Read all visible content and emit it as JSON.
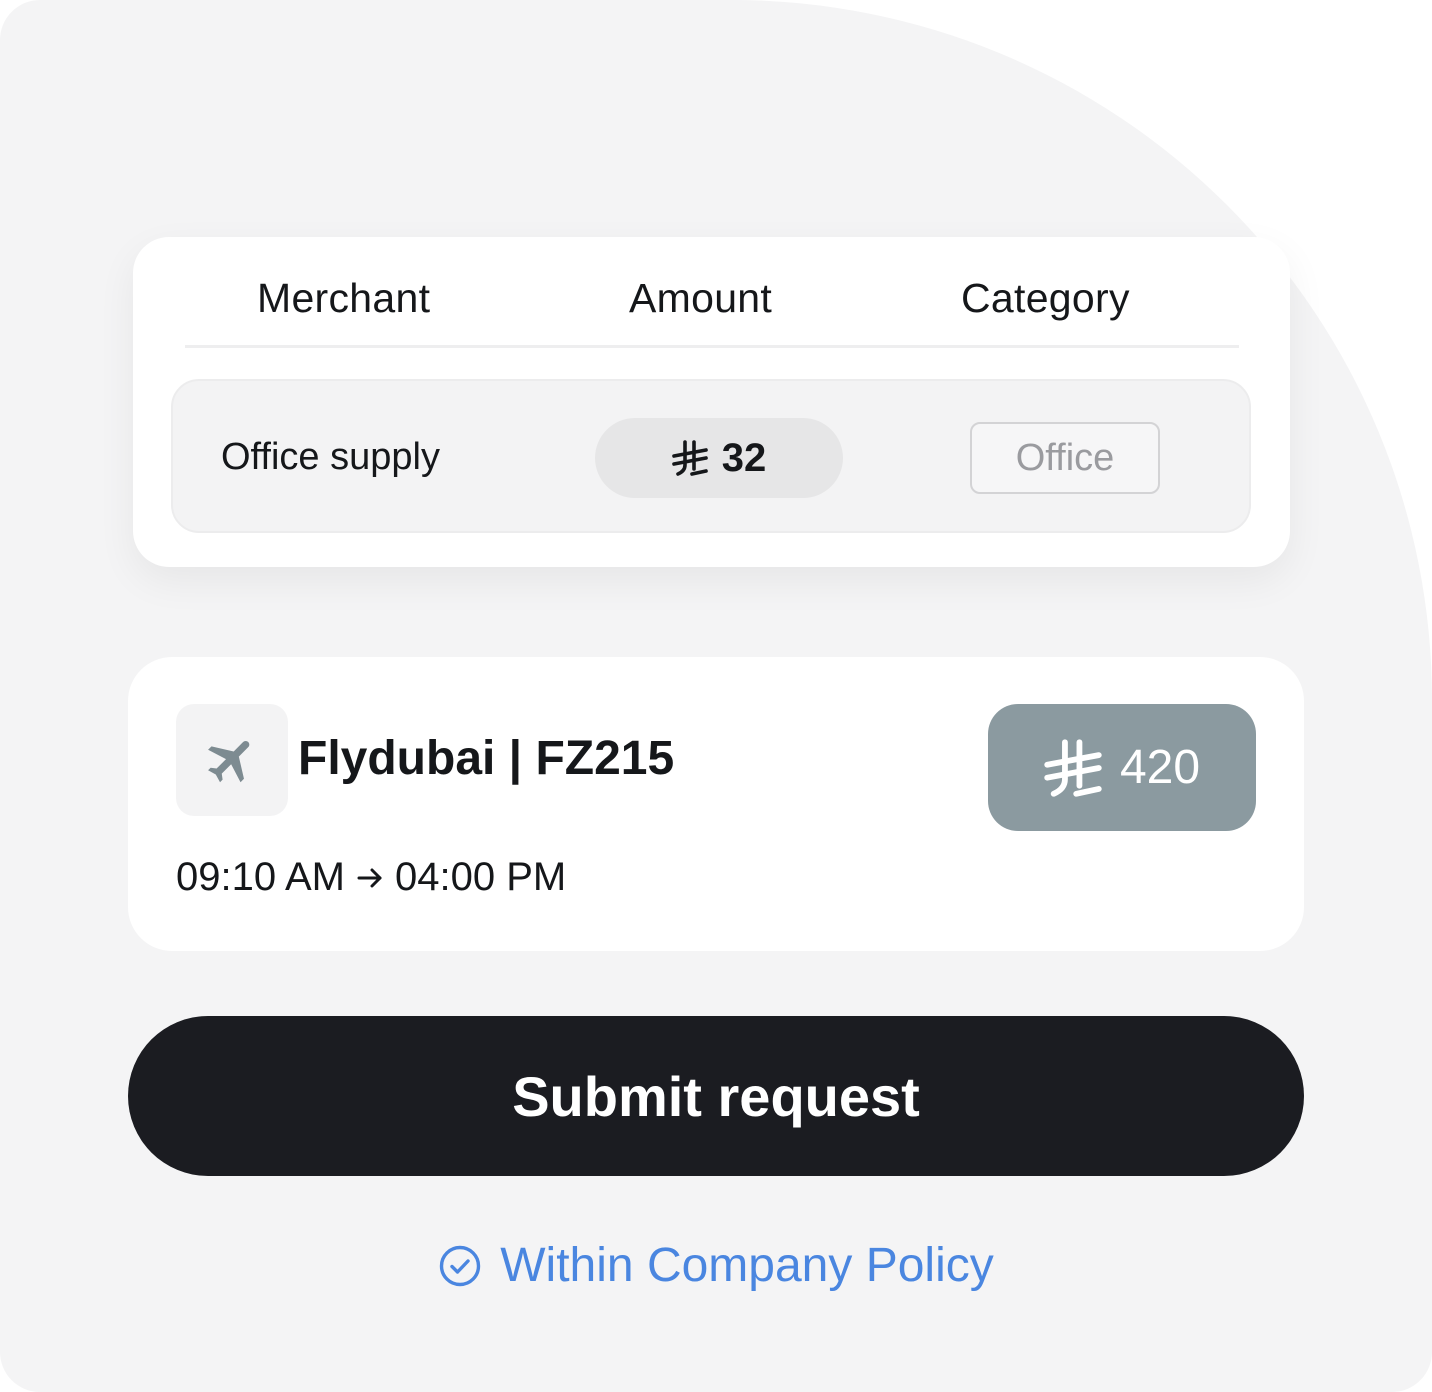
{
  "table": {
    "headers": {
      "merchant": "Merchant",
      "amount": "Amount",
      "category": "Category"
    },
    "row": {
      "merchant": "Office supply",
      "amount": "32",
      "currency_icon": "riyal-currency-icon",
      "category": "Office"
    }
  },
  "flight": {
    "icon": "airplane-icon",
    "title": "Flydubai | FZ215",
    "depart": "09:10 AM",
    "arrive": "04:00 PM",
    "arrow_icon": "arrow-right-icon",
    "price": "420",
    "currency_icon": "riyal-currency-icon"
  },
  "submit": {
    "label": "Submit request"
  },
  "policy": {
    "icon": "check-circle-icon",
    "text": "Within Company Policy"
  },
  "colors": {
    "background": "#f4f4f5",
    "card": "#ffffff",
    "price_badge": "#8b9aa0",
    "submit_button": "#1b1c21",
    "policy_accent": "#4a86e0",
    "text_primary": "#15171a",
    "chip_text": "#9a9b9f"
  }
}
